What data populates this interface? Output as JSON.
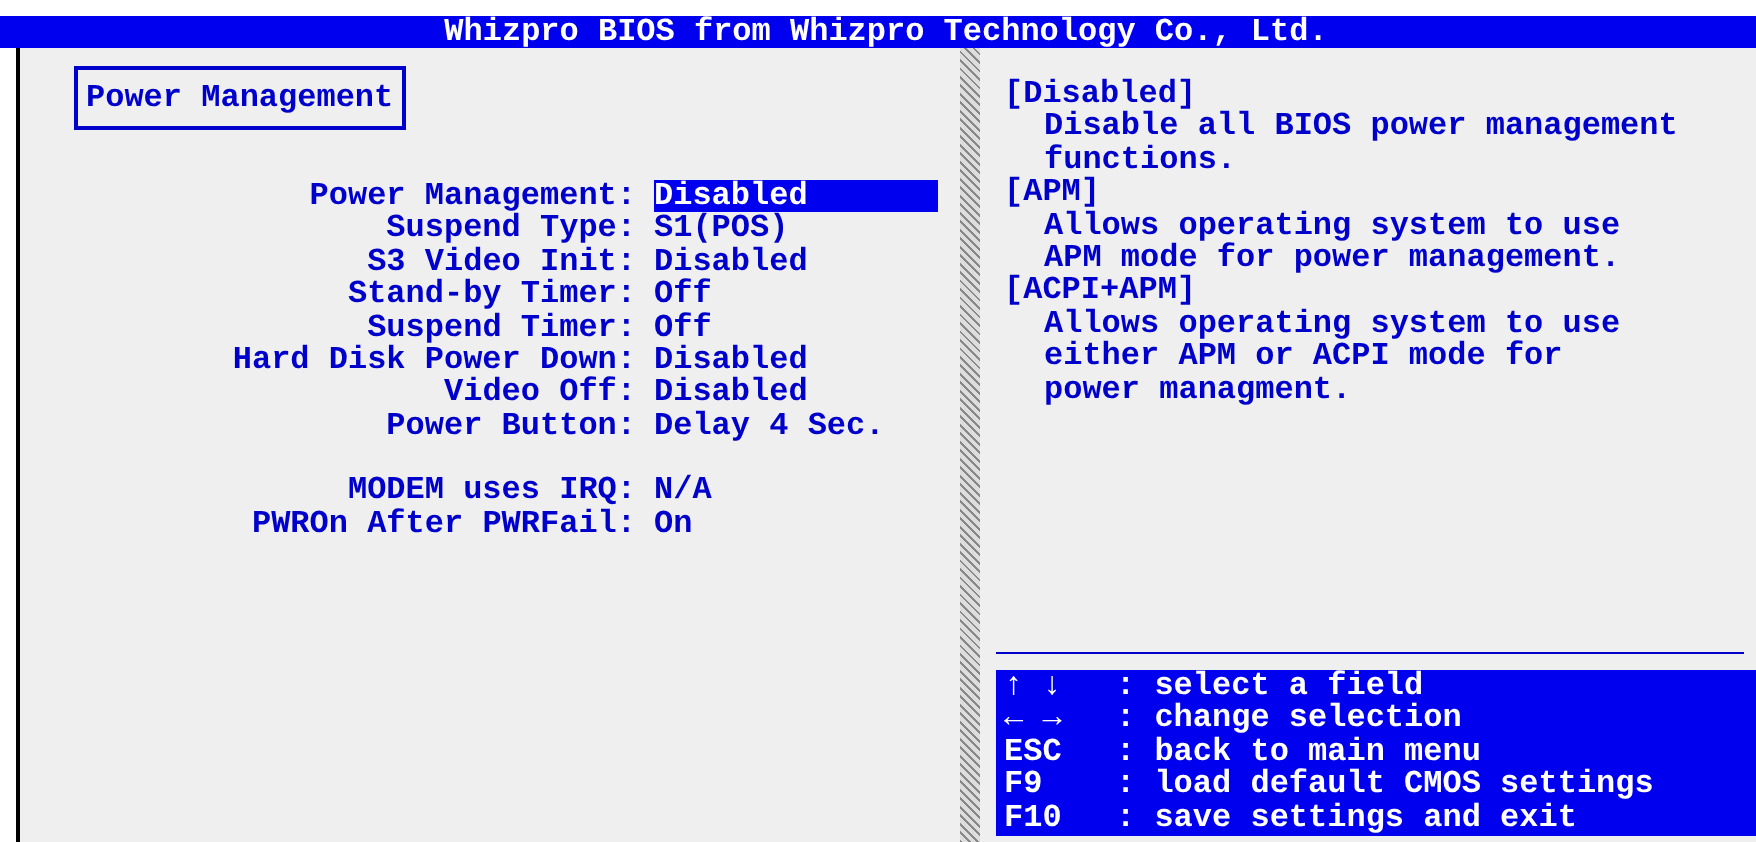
{
  "title": "Whizpro BIOS from Whizpro Technology Co., Ltd.",
  "section_title": "Power Management",
  "setting_groups": [
    {
      "settings": [
        {
          "label": "Power Management:",
          "value": "Disabled",
          "selected": true
        },
        {
          "label": "Suspend Type:",
          "value": "S1(POS)",
          "selected": false
        },
        {
          "label": "S3 Video Init:",
          "value": "Disabled",
          "selected": false
        },
        {
          "label": "Stand-by Timer:",
          "value": "Off",
          "selected": false
        },
        {
          "label": "Suspend Timer:",
          "value": "Off",
          "selected": false
        },
        {
          "label": "Hard Disk Power Down:",
          "value": "Disabled",
          "selected": false
        },
        {
          "label": "Video Off:",
          "value": "Disabled",
          "selected": false
        },
        {
          "label": "Power Button:",
          "value": "Delay 4 Sec.",
          "selected": false
        }
      ]
    },
    {
      "settings": [
        {
          "label": "MODEM uses IRQ:",
          "value": "N/A",
          "selected": false
        },
        {
          "label": "PWROn After PWRFail:",
          "value": "On",
          "selected": false
        }
      ]
    }
  ],
  "help": [
    {
      "kind": "heading",
      "text": "[Disabled]"
    },
    {
      "kind": "text",
      "text": "Disable all BIOS power management"
    },
    {
      "kind": "text",
      "text": "functions."
    },
    {
      "kind": "heading",
      "text": "[APM]"
    },
    {
      "kind": "text",
      "text": "Allows operating system to use"
    },
    {
      "kind": "text",
      "text": "APM mode for power management."
    },
    {
      "kind": "heading",
      "text": "[ACPI+APM]"
    },
    {
      "kind": "text",
      "text": "Allows operating system to use"
    },
    {
      "kind": "text",
      "text": "either APM or ACPI mode for"
    },
    {
      "kind": "text",
      "text": "power managment."
    }
  ],
  "keys": [
    {
      "key": "↑ ↓",
      "description": ": select a field"
    },
    {
      "key": "← →",
      "description": ": change selection"
    },
    {
      "key": "ESC",
      "description": ": back to main menu"
    },
    {
      "key": "F9",
      "description": ": load default CMOS settings"
    },
    {
      "key": "F10",
      "description": ": save settings and exit"
    }
  ]
}
